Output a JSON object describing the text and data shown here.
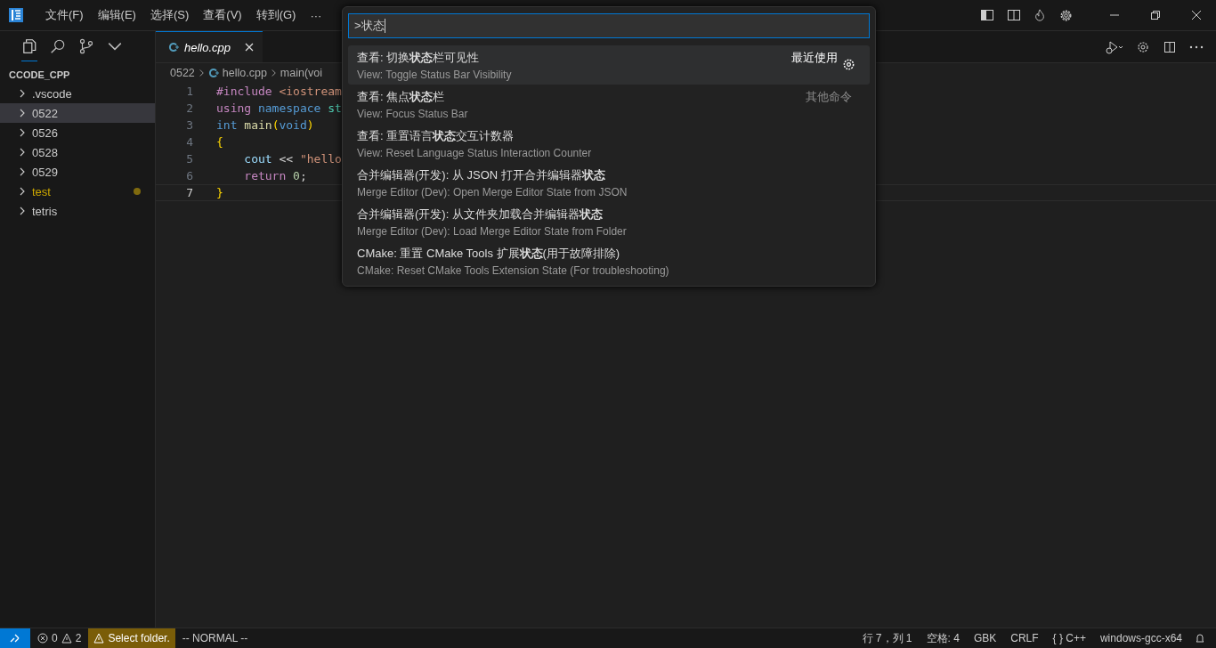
{
  "menu": [
    {
      "label": "文件(F)"
    },
    {
      "label": "编辑(E)"
    },
    {
      "label": "选择(S)"
    },
    {
      "label": "查看(V)"
    },
    {
      "label": "转到(G)"
    },
    {
      "label": "···"
    }
  ],
  "sidebar": {
    "title": "CCODE_CPP",
    "items": [
      {
        "label": ".vscode",
        "selected": false,
        "modified": false
      },
      {
        "label": "0522",
        "selected": true,
        "modified": false
      },
      {
        "label": "0526",
        "selected": false,
        "modified": false
      },
      {
        "label": "0528",
        "selected": false,
        "modified": false
      },
      {
        "label": "0529",
        "selected": false,
        "modified": false
      },
      {
        "label": "test",
        "selected": false,
        "modified": true
      },
      {
        "label": "tetris",
        "selected": false,
        "modified": false
      }
    ]
  },
  "tab": {
    "label": "hello.cpp"
  },
  "breadcrumb": [
    "0522",
    "hello.cpp",
    "main(voi"
  ],
  "code": [
    {
      "number": "1",
      "current": false,
      "tokens": [
        {
          "t": "#include ",
          "kind": "control"
        },
        {
          "t": "<iostream",
          "kind": "string"
        }
      ]
    },
    {
      "number": "2",
      "current": false,
      "tokens": [
        {
          "t": "using ",
          "kind": "control"
        },
        {
          "t": "namespace ",
          "kind": "keyword"
        },
        {
          "t": "st",
          "kind": "type"
        }
      ]
    },
    {
      "number": "3",
      "current": false,
      "tokens": [
        {
          "t": "int ",
          "kind": "keyword"
        },
        {
          "t": "main",
          "kind": "function"
        },
        {
          "t": "(",
          "kind": "bracket"
        },
        {
          "t": "void",
          "kind": "keyword"
        },
        {
          "t": ")",
          "kind": "bracket"
        }
      ]
    },
    {
      "number": "4",
      "current": false,
      "tokens": [
        {
          "t": "{",
          "kind": "bracket"
        }
      ]
    },
    {
      "number": "5",
      "current": false,
      "tokens": [
        {
          "t": "    cout ",
          "kind": "variable"
        },
        {
          "t": "<< ",
          "kind": "plain"
        },
        {
          "t": "\"hello",
          "kind": "string"
        }
      ]
    },
    {
      "number": "6",
      "current": false,
      "tokens": [
        {
          "t": "    return ",
          "kind": "control"
        },
        {
          "t": "0",
          "kind": "number"
        },
        {
          "t": ";",
          "kind": "plain"
        }
      ]
    },
    {
      "number": "7",
      "current": true,
      "tokens": [
        {
          "t": "}",
          "kind": "bracket"
        }
      ]
    }
  ],
  "palette": {
    "input": ">状态",
    "items": [
      {
        "label": "查看: 切换**状态**栏可见性",
        "detail": "View: Toggle Status Bar Visibility",
        "tag": "最近使用",
        "selected": true
      },
      {
        "label": "查看: 焦点**状态**栏",
        "detail": "View: Focus Status Bar",
        "tag": "其他命令",
        "selected": false
      },
      {
        "label": "查看: 重置语言**状态**交互计数器",
        "detail": "View: Reset Language Status Interaction Counter",
        "selected": false
      },
      {
        "label": "合并编辑器(开发): 从 JSON 打开合并编辑器**状态**",
        "detail": "Merge Editor (Dev): Open Merge Editor State from JSON",
        "selected": false
      },
      {
        "label": "合并编辑器(开发): 从文件夹加载合并编辑器**状态**",
        "detail": "Merge Editor (Dev): Load Merge Editor State from Folder",
        "selected": false
      },
      {
        "label": "CMake: 重置 CMake Tools 扩展**状态**(用于故障排除)",
        "detail": "CMake: Reset CMake Tools Extension State (For troubleshooting)",
        "selected": false
      }
    ]
  },
  "status_bar": {
    "errors": "0",
    "warnings": "2",
    "notice": "Select folder.",
    "mode": "-- NORMAL --",
    "right": [
      "行 7，列 1",
      "空格: 4",
      "GBK",
      "CRLF",
      "{ } C++",
      "windows-gcc-x64"
    ]
  }
}
